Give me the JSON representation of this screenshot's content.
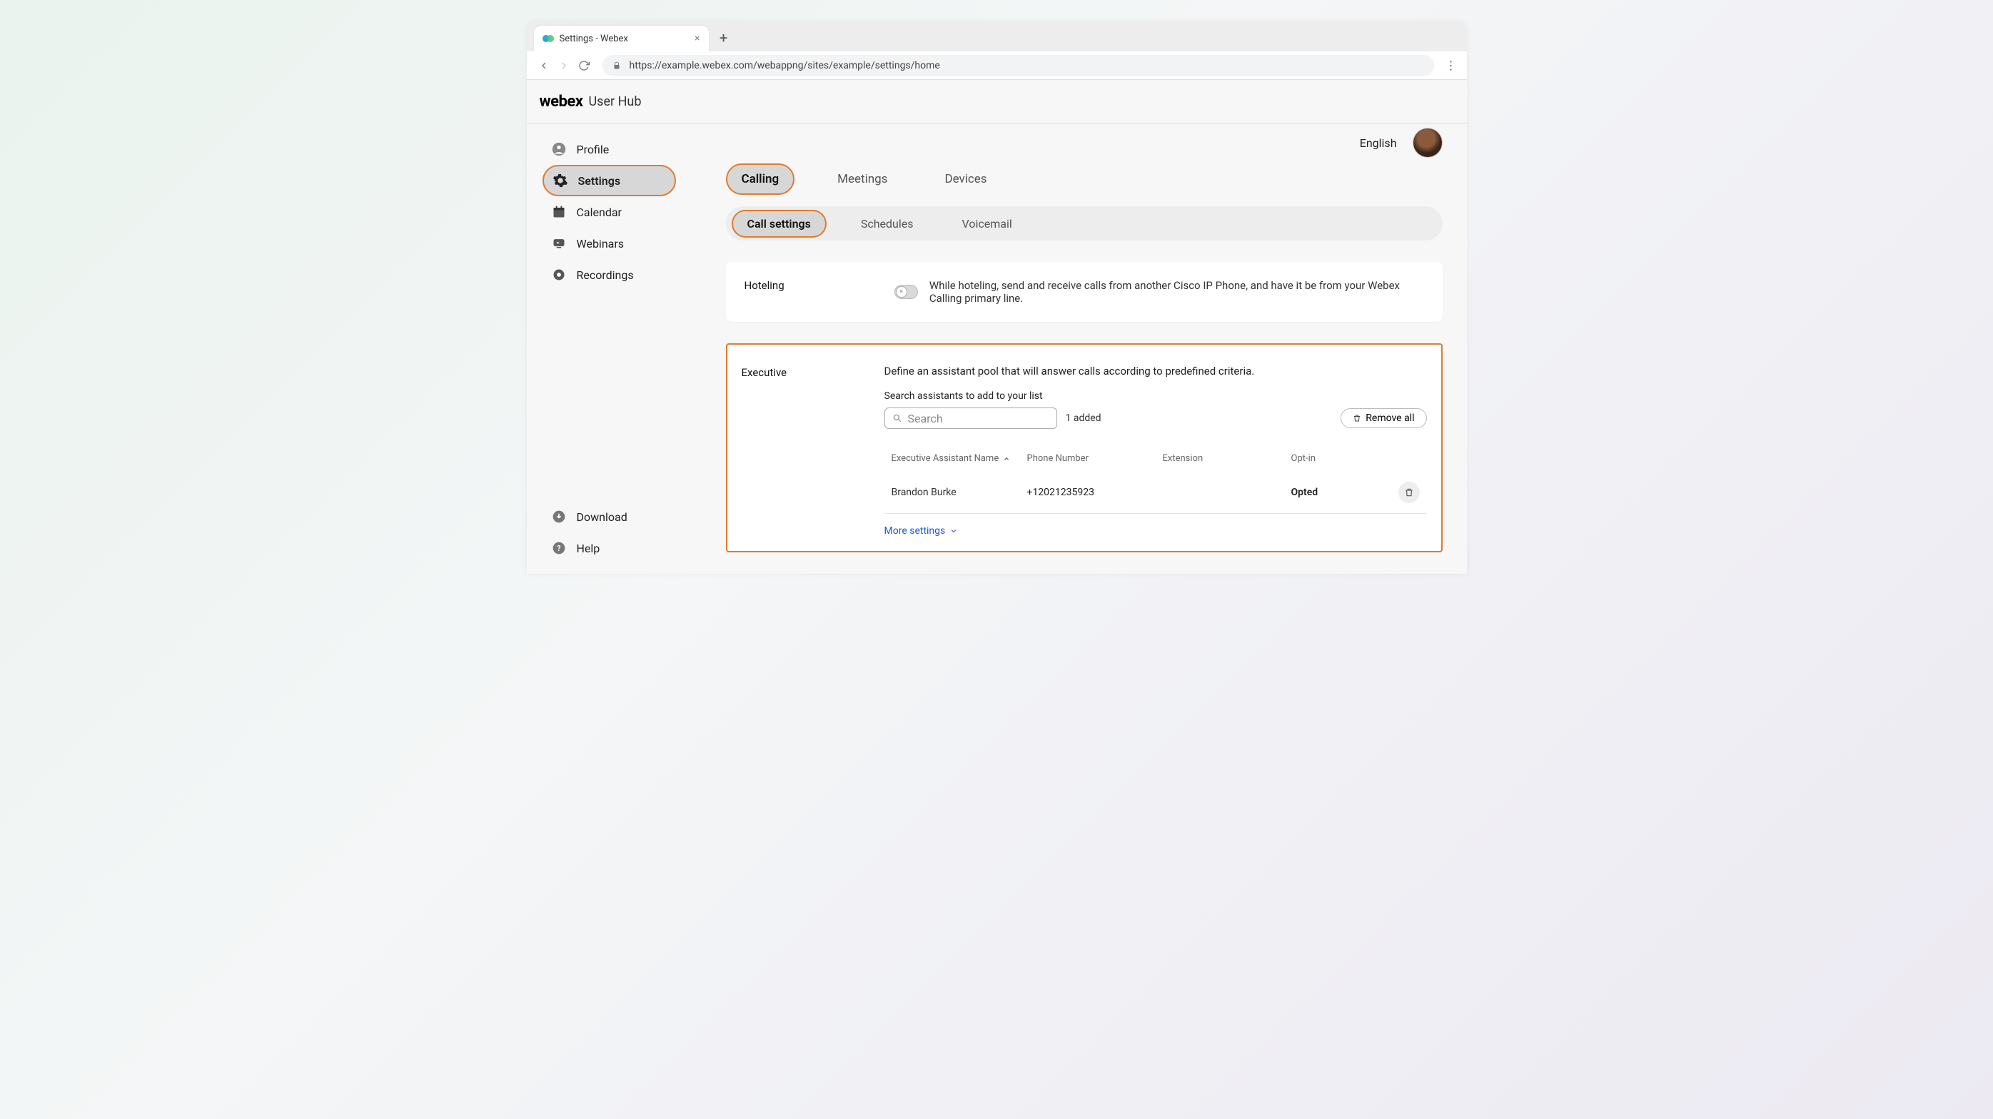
{
  "browser": {
    "tab_title": "Settings - Webex",
    "url": "https://example.webex.com/webappng/sites/example/settings/home"
  },
  "header": {
    "brand": "webex",
    "brand_sub": "User Hub",
    "language": "English"
  },
  "sidebar": {
    "items": [
      {
        "label": "Profile"
      },
      {
        "label": "Settings"
      },
      {
        "label": "Calendar"
      },
      {
        "label": "Webinars"
      },
      {
        "label": "Recordings"
      }
    ],
    "footer": [
      {
        "label": "Download"
      },
      {
        "label": "Help"
      }
    ]
  },
  "top_tabs": [
    "Calling",
    "Meetings",
    "Devices"
  ],
  "sub_tabs": [
    "Call settings",
    "Schedules",
    "Voicemail"
  ],
  "hoteling": {
    "title": "Hoteling",
    "desc": "While hoteling, send and receive calls from another Cisco IP Phone, and have it be from your Webex Calling primary line."
  },
  "executive": {
    "title": "Executive",
    "desc": "Define an assistant pool that will answer calls according to predefined criteria.",
    "search_label": "Search assistants to add to your list",
    "search_placeholder": "Search",
    "added_count": "1 added",
    "remove_all": "Remove all",
    "columns": {
      "name": "Executive Assistant Name",
      "phone": "Phone Number",
      "ext": "Extension",
      "opt": "Opt-in"
    },
    "rows": [
      {
        "name": "Brandon Burke",
        "phone": "+12021235923",
        "ext": "",
        "opt": "Opted"
      }
    ],
    "more": "More settings"
  }
}
